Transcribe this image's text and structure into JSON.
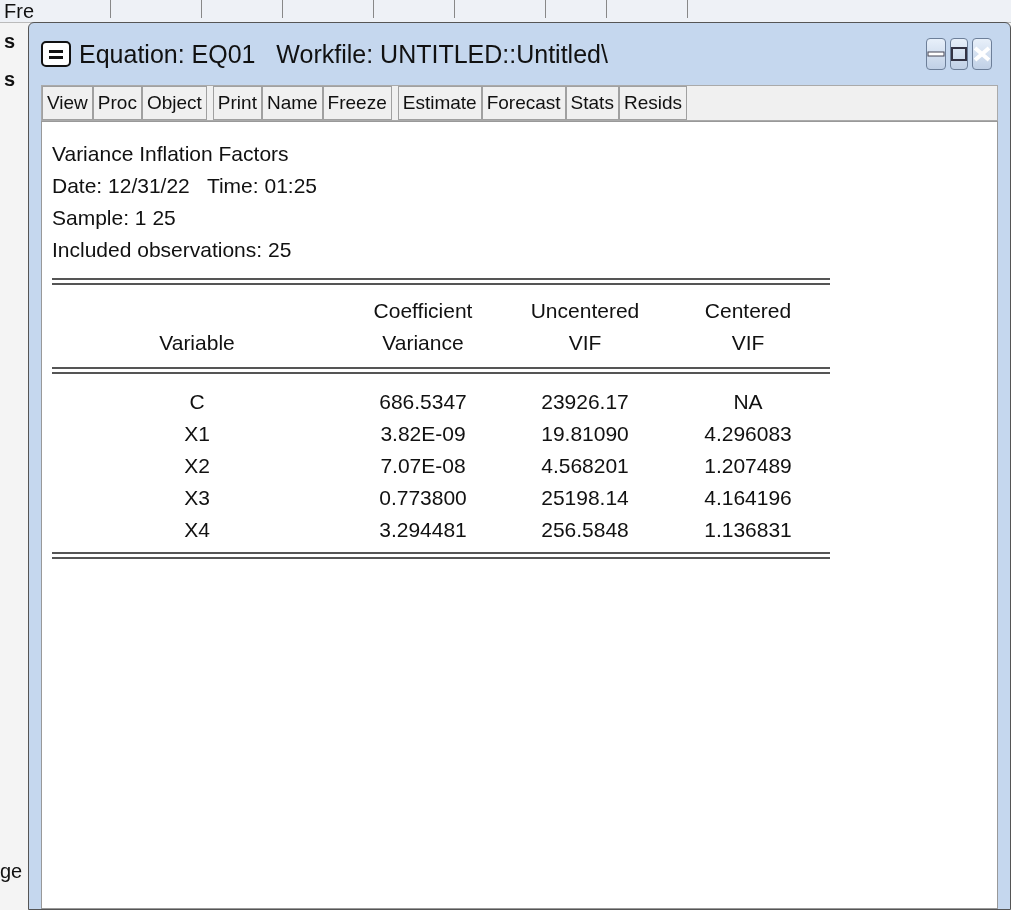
{
  "background": {
    "fragments": [
      "Fre",
      "s",
      "s",
      "ge"
    ]
  },
  "window": {
    "title": "Equation: EQ01   Workfile: UNTITLED::Untitled\\"
  },
  "toolbar": [
    [
      "View",
      "Proc",
      "Object"
    ],
    [
      "Print",
      "Name",
      "Freeze"
    ],
    [
      "Estimate",
      "Forecast",
      "Stats",
      "Resids"
    ]
  ],
  "header": [
    "Variance Inflation Factors",
    "Date: 12/31/22   Time: 01:25",
    "Sample: 1 25",
    "Included observations: 25"
  ],
  "table": {
    "columns": [
      "Variable",
      "Coefficient Variance",
      "Uncentered VIF",
      "Centered VIF"
    ],
    "rows": [
      [
        "C",
        "686.5347",
        "23926.17",
        "NA"
      ],
      [
        "X1",
        "3.82E-09",
        "19.81090",
        "4.296083"
      ],
      [
        "X2",
        "7.07E-08",
        "4.568201",
        "1.207489"
      ],
      [
        "X3",
        "0.773800",
        "25198.14",
        "4.164196"
      ],
      [
        "X4",
        "3.294481",
        "256.5848",
        "1.136831"
      ]
    ]
  }
}
